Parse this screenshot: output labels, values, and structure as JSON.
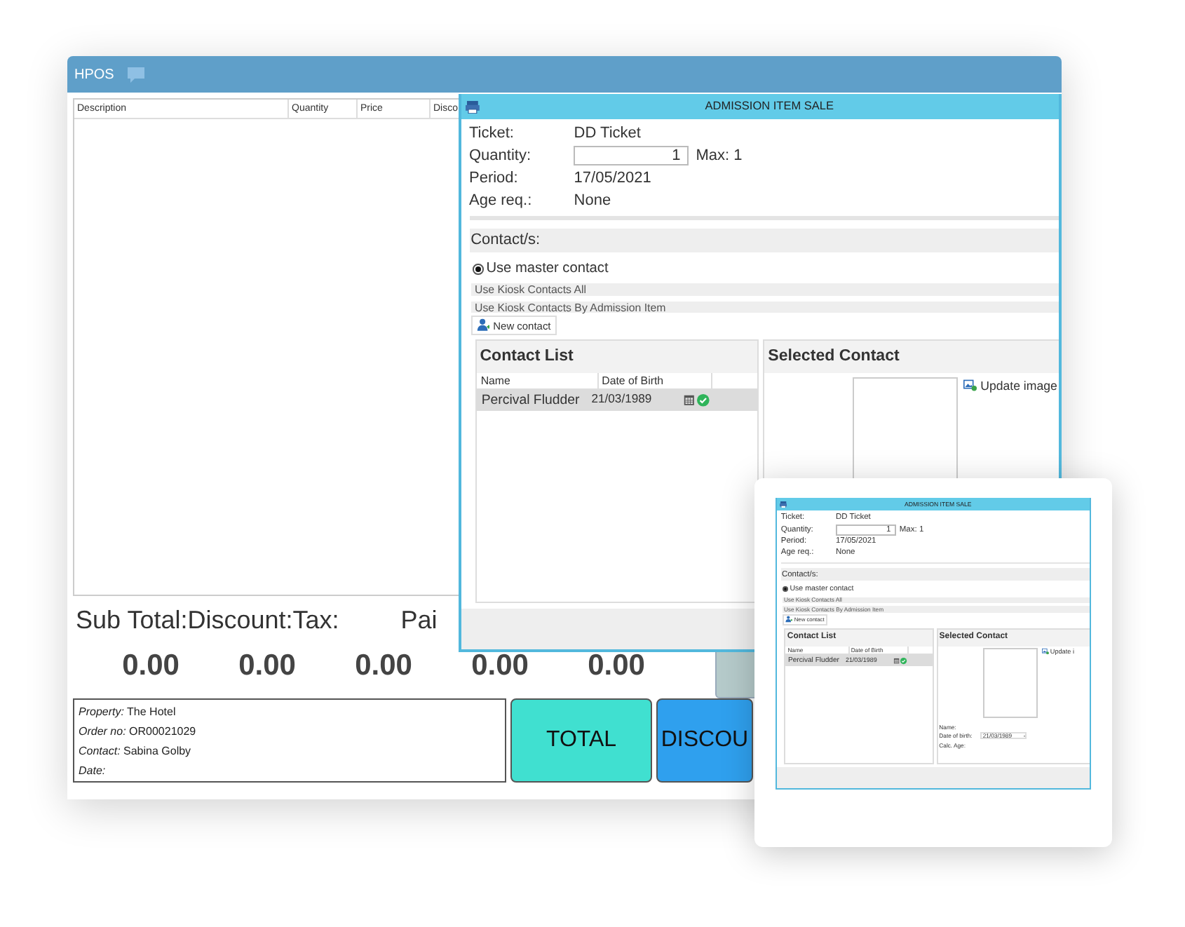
{
  "window": {
    "title": "HPOS"
  },
  "order_table": {
    "columns": [
      "Description",
      "Quantity",
      "Price",
      "Disco"
    ]
  },
  "totals": {
    "labels": [
      "Sub Total:Discount:Tax:",
      "Pai"
    ],
    "values": [
      "0.00",
      "0.00",
      "0.00",
      "0.00",
      "0.00"
    ]
  },
  "order_info": [
    {
      "label": "Property:",
      "value": "The Hotel"
    },
    {
      "label": "Order no:",
      "value": "OR00021029"
    },
    {
      "label": "Contact:",
      "value": "Sabina Golby"
    },
    {
      "label": "Date:"
    }
  ],
  "buttons": [
    {
      "label": "TOTAL",
      "color": "#40e0d0"
    },
    {
      "label": "DISCOU",
      "color": "#2fa0ee"
    }
  ],
  "dialog": {
    "title": "ADMISSION ITEM SALE",
    "fields": [
      {
        "label": "Ticket:",
        "value": "DD Ticket"
      },
      {
        "label": "Quantity:",
        "kind": "input",
        "value": "1",
        "note": "Max: 1"
      },
      {
        "label": "Period:",
        "value": "17/05/2021"
      },
      {
        "label": "Age req.:",
        "value": "None"
      }
    ],
    "contacts_heading": "Contact/s:",
    "options": [
      {
        "label": "Use master contact",
        "kind": "radio",
        "selected": true
      },
      {
        "label": "Use Kiosk Contacts All",
        "kind": "bar"
      },
      {
        "label": "Use Kiosk Contacts By Admission Item",
        "kind": "bar"
      }
    ],
    "new_contact": "New contact",
    "contact_list": {
      "title": "Contact List",
      "columns": [
        "Name",
        "Date of Birth"
      ],
      "rows": [
        {
          "name": "Percival Fludder",
          "dob": "21/03/1989",
          "selected": true,
          "verified": true
        }
      ]
    },
    "selected_contact": {
      "title": "Selected Contact",
      "update_image": "Update image"
    }
  },
  "inset_dialog": {
    "title": "ADMISSION ITEM SALE",
    "fields": [
      {
        "label": "Ticket:",
        "value": "DD Ticket"
      },
      {
        "label": "Quantity:",
        "kind": "input",
        "value": "1",
        "note": "Max: 1"
      },
      {
        "label": "Period:",
        "value": "17/05/2021"
      },
      {
        "label": "Age req.:",
        "value": "None"
      }
    ],
    "contacts_heading": "Contact/s:",
    "options": [
      {
        "label": "Use master contact",
        "kind": "radio",
        "selected": true
      },
      {
        "label": "Use Kiosk Contacts All",
        "kind": "bar"
      },
      {
        "label": "Use Kiosk Contacts By Admission Item",
        "kind": "bar"
      }
    ],
    "new_contact": "New contact",
    "contact_list": {
      "title": "Contact List",
      "columns": [
        "Name",
        "Date of Birth"
      ],
      "rows": [
        {
          "name": "Percival Fludder",
          "dob": "21/03/1989",
          "selected": true,
          "verified": true
        }
      ]
    },
    "selected_contact": {
      "title": "Selected Contact",
      "update_image": "Update i",
      "details": [
        {
          "label": "Name:"
        },
        {
          "label": "Date of birth:",
          "kind": "date",
          "value": "21/03/1989"
        },
        {
          "label": "Calc. Age:"
        }
      ]
    }
  }
}
